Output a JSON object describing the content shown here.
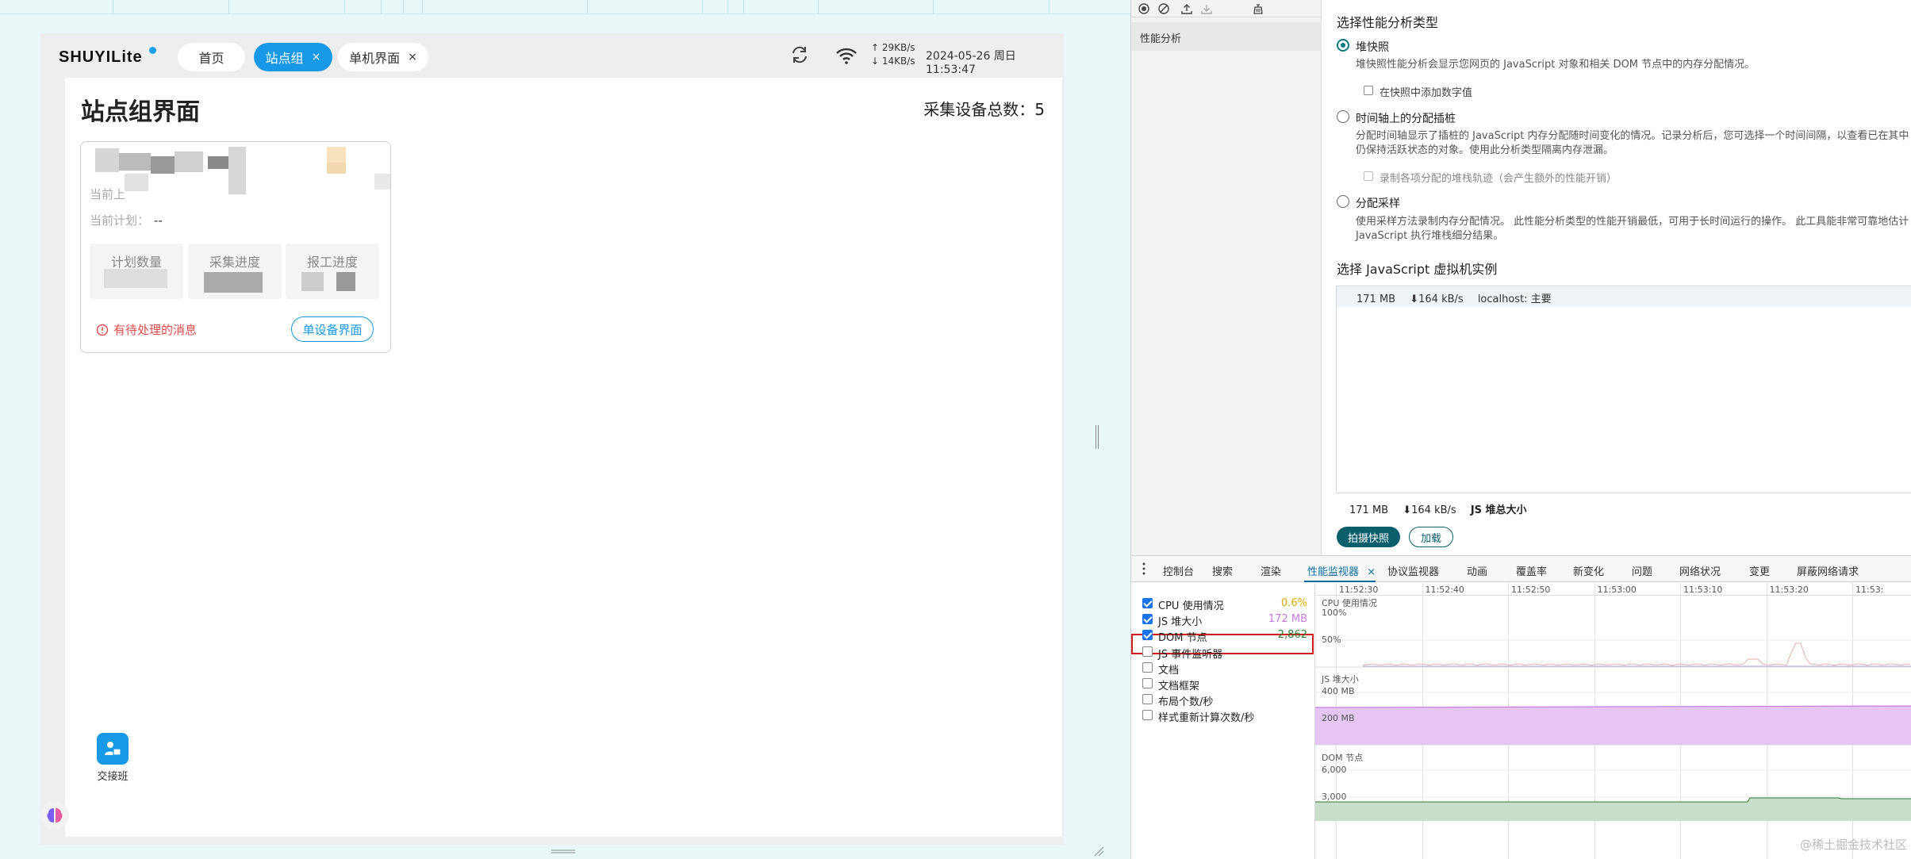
{
  "app": {
    "logo": "SHUYILite",
    "tabs": [
      {
        "label": "首页"
      },
      {
        "label": "站点组",
        "close": "×"
      },
      {
        "label": "单机界面",
        "close": "×"
      }
    ],
    "upload_speed": "↑ 29KB/s",
    "download_speed": "↓ 14KB/s",
    "datetime": "2024-05-26 周日 11:53:47",
    "page_title": "站点组界面",
    "device_total": "采集设备总数：5",
    "card": {
      "line1_label": "当前上",
      "line2_label": "当前计划：",
      "line2_value": "--",
      "stat1": "计划数量",
      "stat2": "采集进度",
      "stat3": "报工进度",
      "pending": "有待处理的消息",
      "single_button": "单设备界面"
    },
    "handover_label": "交接班"
  },
  "devtools": {
    "sidebar_item": "性能分析",
    "select_type_title": "选择性能分析类型",
    "options": [
      {
        "label": "堆快照",
        "desc": "堆快照性能分析会显示您网页的 JavaScript 对象和相关 DOM 节点中的内存分配情况。",
        "checkbox": "在快照中添加数字值"
      },
      {
        "label": "时间轴上的分配插桩",
        "desc": "分配时间轴显示了插桩的 JavaScript 内存分配随时间变化的情况。记录分析后，您可选择一个时间间隔，以查看已在其中",
        "desc2": "仍保持活跃状态的对象。使用此分析类型隔离内存泄漏。",
        "checkbox": "录制各项分配的堆栈轨迹（会产生额外的性能开销）"
      },
      {
        "label": "分配采样",
        "desc": "使用采样方法录制内存分配情况。 此性能分析类型的性能开销最低，可用于长时间运行的操作。 此工具能非常可靠地估计",
        "desc2": "JavaScript 执行堆栈细分结果。"
      }
    ],
    "vm_title": "选择 JavaScript 虚拟机实例",
    "vm_row": {
      "size": "171 MB",
      "rate": "⬇164 kB/s",
      "name": "localhost: 主要"
    },
    "vm_total": {
      "size": "171 MB",
      "rate": "⬇164 kB/s",
      "label": "JS 堆总大小"
    },
    "snapshot_button": "拍摄快照",
    "load_button": "加载",
    "drawer_tabs": [
      "控制台",
      "搜索",
      "渲染",
      "性能监视器",
      "协议监视器",
      "动画",
      "覆盖率",
      "新变化",
      "问题",
      "网络状况",
      "变更",
      "屏蔽网络请求"
    ],
    "drawer_close": "×",
    "metrics": [
      {
        "label": "CPU 使用情况",
        "value": "0.6%",
        "checked": true,
        "color": "#e0a800"
      },
      {
        "label": "JS 堆大小",
        "value": "172 MB",
        "checked": true,
        "color": "#c77be0"
      },
      {
        "label": "DOM 节点",
        "value": "2,862",
        "checked": true,
        "color": "#2e7d32"
      },
      {
        "label": "JS 事件监听器",
        "value": "",
        "checked": false
      },
      {
        "label": "文档",
        "value": "",
        "checked": false
      },
      {
        "label": "文档框架",
        "value": "",
        "checked": false
      },
      {
        "label": "布局个数/秒",
        "value": "",
        "checked": false
      },
      {
        "label": "样式重新计算次数/秒",
        "value": "",
        "checked": false
      }
    ],
    "time_labels": [
      "11:52:30",
      "11:52:40",
      "11:52:50",
      "11:53:00",
      "11:53:10",
      "11:53:20",
      "11:53:"
    ],
    "graphs": {
      "cpu_title": "CPU 使用情况",
      "cpu_100": "100%",
      "cpu_50": "50%",
      "heap_title": "JS 堆大小",
      "heap_400": "400 MB",
      "heap_200": "200 MB",
      "dom_title": "DOM 节点",
      "dom_6000": "6,000",
      "dom_3000": "3,000"
    },
    "watermark": "@稀土掘金技术社区"
  }
}
